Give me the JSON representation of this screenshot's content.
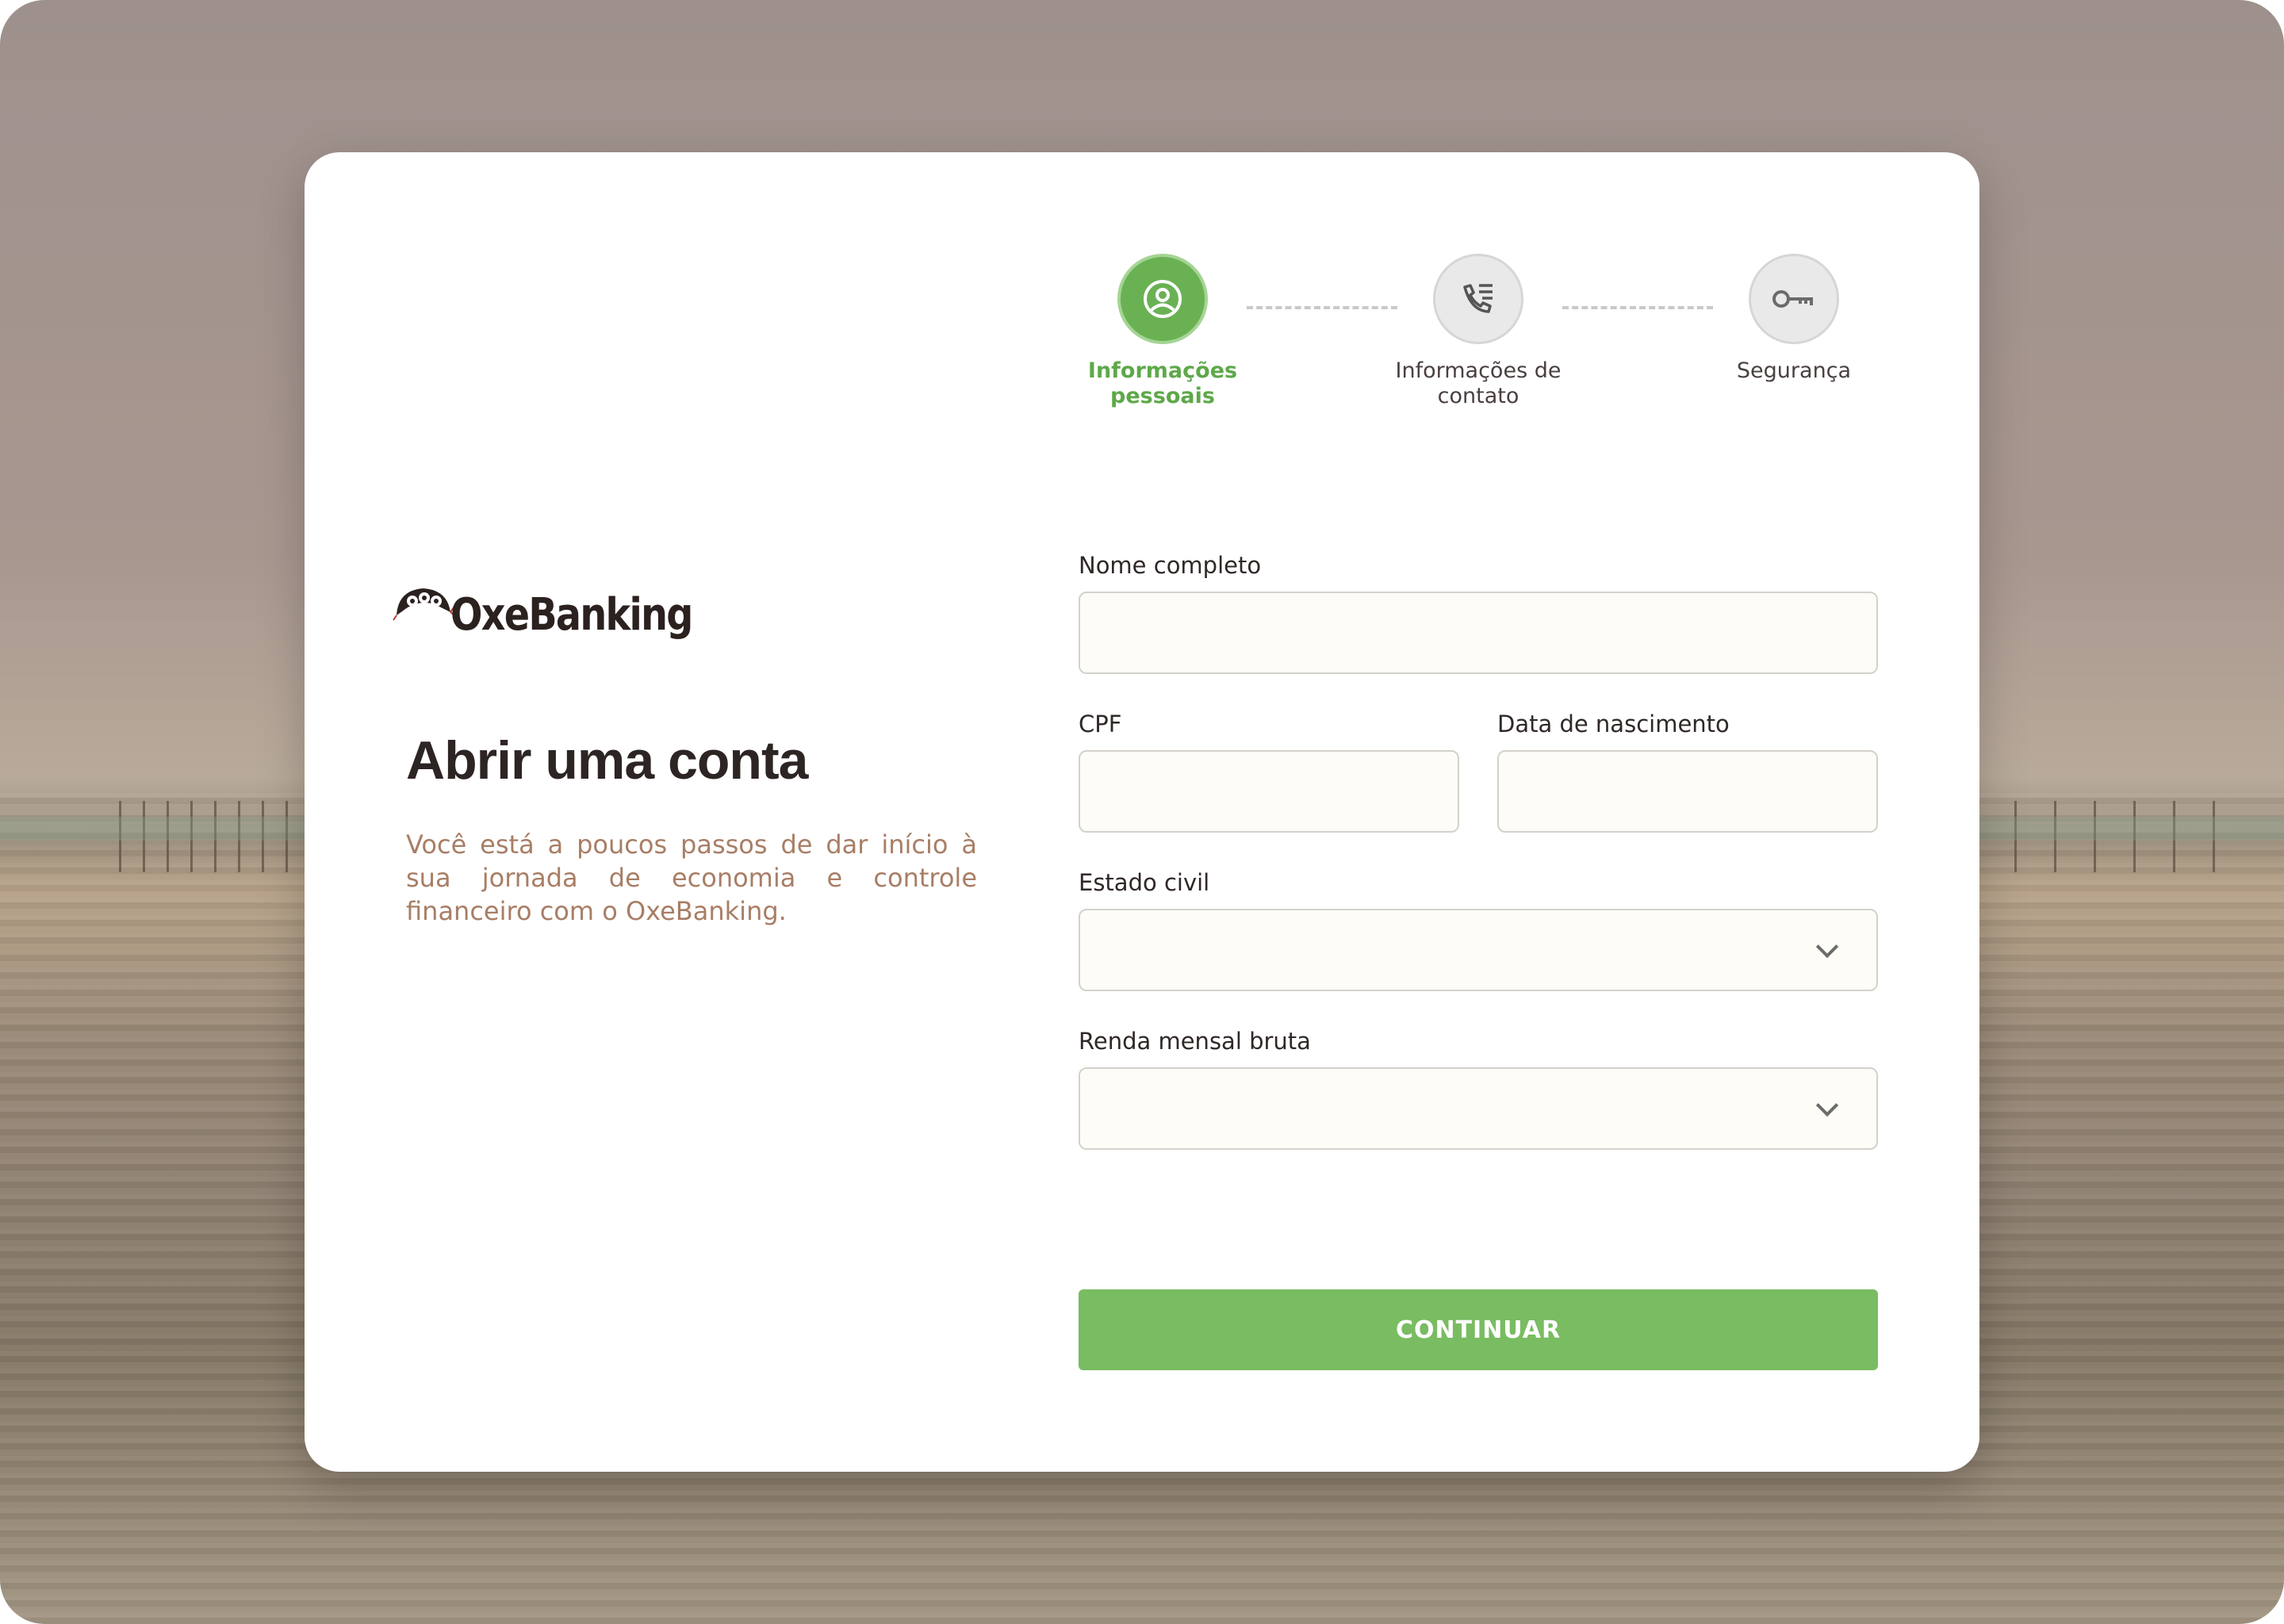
{
  "brand": {
    "name": "OxeBanking"
  },
  "stepper": {
    "steps": [
      {
        "label_line1": "Informações",
        "label_line2": "pessoais",
        "icon": "user-circle-icon",
        "state": "active"
      },
      {
        "label_line1": "Informações de",
        "label_line2": "contato",
        "icon": "phone-list-icon",
        "state": "inactive"
      },
      {
        "label_line1": "Segurança",
        "label_line2": "",
        "icon": "key-icon",
        "state": "inactive"
      }
    ]
  },
  "intro": {
    "title": "Abrir uma conta",
    "description": "Você está a poucos passos de dar início à sua jornada de economia e controle financeiro com o OxeBanking."
  },
  "form": {
    "full_name": {
      "label": "Nome completo",
      "value": ""
    },
    "cpf": {
      "label": "CPF",
      "value": ""
    },
    "birth_date": {
      "label": "Data de nascimento",
      "value": ""
    },
    "marital_status": {
      "label": "Estado civil",
      "value": ""
    },
    "monthly_income": {
      "label": "Renda mensal bruta",
      "value": ""
    },
    "submit_label": "CONTINUAR"
  },
  "colors": {
    "accent": "#79bc62",
    "accent_dark": "#5ea84a",
    "description_text": "#a87e66"
  }
}
